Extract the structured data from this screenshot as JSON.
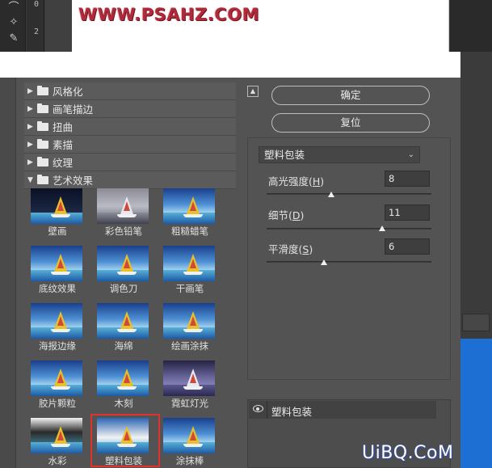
{
  "ps": {
    "ruler_marks": [
      "0",
      "2"
    ],
    "watermark": "WWW.PSAHZ.COM"
  },
  "tree": {
    "items": [
      {
        "label": "风格化",
        "expanded": false
      },
      {
        "label": "画笔描边",
        "expanded": false
      },
      {
        "label": "扭曲",
        "expanded": false
      },
      {
        "label": "素描",
        "expanded": false
      },
      {
        "label": "纹理",
        "expanded": false
      },
      {
        "label": "艺术效果",
        "expanded": true
      }
    ]
  },
  "thumbs": [
    {
      "label": "壁画",
      "variant": "v-dark"
    },
    {
      "label": "彩色铅笔",
      "variant": "v-gray"
    },
    {
      "label": "粗糙蜡笔",
      "variant": ""
    },
    {
      "label": "底纹效果",
      "variant": ""
    },
    {
      "label": "调色刀",
      "variant": ""
    },
    {
      "label": "干画笔",
      "variant": ""
    },
    {
      "label": "海报边缘",
      "variant": ""
    },
    {
      "label": "海绵",
      "variant": ""
    },
    {
      "label": "绘画涂抹",
      "variant": ""
    },
    {
      "label": "胶片颗粒",
      "variant": ""
    },
    {
      "label": "木刻",
      "variant": ""
    },
    {
      "label": "霓虹灯光",
      "variant": "v-purple"
    },
    {
      "label": "水彩",
      "variant": "v-water"
    },
    {
      "label": "塑料包装",
      "variant": "v-paint",
      "selected": true
    },
    {
      "label": "涂抹棒",
      "variant": ""
    }
  ],
  "buttons": {
    "ok": "确定",
    "reset": "复位"
  },
  "filter": {
    "selected": "塑料包装"
  },
  "params": [
    {
      "label_pre": "高光强度(",
      "key": "H",
      "label_post": ")",
      "value": "8",
      "min": 0,
      "max": 20
    },
    {
      "label_pre": "细节(",
      "key": "D",
      "label_post": ")",
      "value": "11",
      "min": 1,
      "max": 15
    },
    {
      "label_pre": "平滑度(",
      "key": "S",
      "label_post": ")",
      "value": "6",
      "min": 1,
      "max": 15
    }
  ],
  "layers": {
    "name": "塑料包装"
  },
  "site": {
    "mark": "UiBQ.CoM"
  },
  "colors": {
    "selection_border": "#e0312f",
    "watermark": "#b02a3a",
    "accent_blue": "#1e6fd4"
  }
}
